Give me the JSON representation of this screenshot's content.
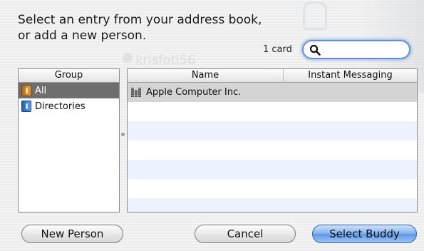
{
  "dialog": {
    "prompt_line1": "Select an entry from your address book,",
    "prompt_line2": "or add a new person.",
    "card_count": "1 card",
    "search_value": "",
    "background_ghost_text": "krisfoti56"
  },
  "group_pane": {
    "header": "Group",
    "items": [
      {
        "label": "All",
        "icon": "address-book-orange-icon",
        "selected": true
      },
      {
        "label": "Directories",
        "icon": "address-book-blue-icon",
        "selected": false
      }
    ]
  },
  "table": {
    "columns": [
      "Name",
      "Instant Messaging"
    ],
    "rows": [
      {
        "name": "Apple Computer Inc.",
        "instant_messaging": "",
        "icon": "company-building-icon",
        "selected": true
      }
    ]
  },
  "buttons": {
    "new_person": "New Person",
    "cancel": "Cancel",
    "select_buddy": "Select Buddy"
  },
  "colors": {
    "accent_blue": "#5d97e6",
    "selection_gray": "#6e6e6e",
    "row_stripe": "#edf3fe"
  }
}
